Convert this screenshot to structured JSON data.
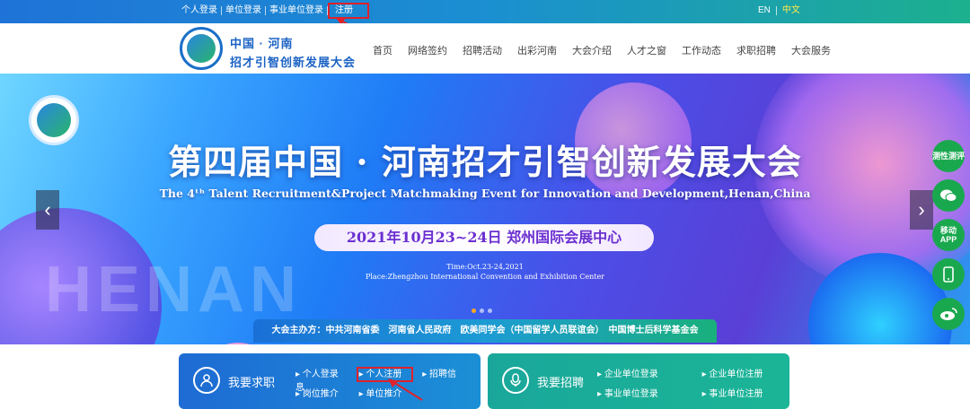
{
  "topbar": {
    "links": [
      "个人登录",
      "单位登录",
      "事业单位登录",
      "注册"
    ],
    "lang_en": "EN",
    "lang_zh": "中文"
  },
  "header": {
    "brand_line1": "中国 · 河南",
    "brand_line2": "招才引智创新发展大会",
    "nav": [
      "首页",
      "网络签约",
      "招聘活动",
      "出彩河南",
      "大会介绍",
      "人才之窗",
      "工作动态",
      "求职招聘",
      "大会服务"
    ]
  },
  "banner": {
    "headline": "第四届中国 · 河南招才引智创新发展大会",
    "subline": "The 4ᵗʰ Talent Recruitment&Project Matchmaking Event for Innovation and Development,Henan,China",
    "date": "2021年10月23~24日 郑州国际会展中心",
    "time_line": "Time:Oct.23-24,2021",
    "place_line": "Place:Zhengzhou International Convention and Exhibition Center",
    "bg_letters": "HENAN",
    "sponsor": "大会主办方：中共河南省委　河南省人民政府　欧美同学会（中国留学人员联谊会）　中国博士后科学基金会",
    "prev_arrow": "‹",
    "next_arrow": "›"
  },
  "dock": {
    "items": [
      "测性测评",
      "微信",
      "移动APP",
      "手机",
      "微博"
    ]
  },
  "cards": {
    "job": {
      "title": "我要求职",
      "links": [
        "个人登录",
        "个人注册",
        "招聘信息",
        "岗位推介",
        "单位推介"
      ]
    },
    "hire": {
      "title": "我要招聘",
      "links": [
        "企业单位登录",
        "企业单位注册",
        "事业单位登录",
        "事业单位注册"
      ]
    }
  },
  "colors": {
    "accent_red": "#e0222a",
    "brand_blue": "#1a62c4",
    "brand_green": "#1aa84f"
  }
}
